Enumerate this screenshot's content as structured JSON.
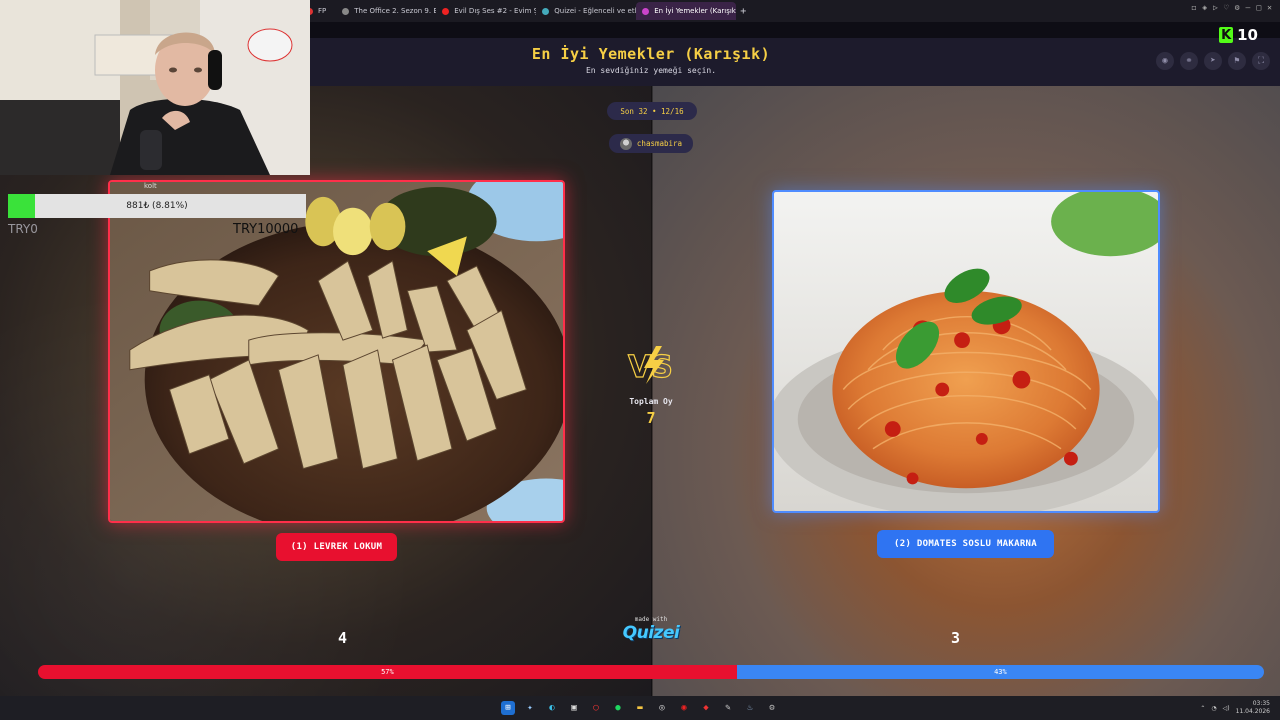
{
  "browser": {
    "tabs": [
      {
        "label": "FP",
        "color": "#d33"
      },
      {
        "label": "The Office 2. Sezon 9. Bö",
        "color": "#888"
      },
      {
        "label": "Evil Dış Ses #2 - Evim Şa",
        "color": "#e22"
      },
      {
        "label": "Quizei - Eğlenceli ve etkil",
        "color": "#4ab"
      },
      {
        "label": "En İyi Yemekler (Karışık)",
        "color": "#c4c",
        "active": true
      }
    ],
    "new_tab": "+",
    "kick_viewers": "10"
  },
  "header": {
    "title": "En İyi Yemekler (Karışık)",
    "subtitle": "En sevdiğiniz yemeği seçin.",
    "icons": [
      "eye-icon",
      "link-icon",
      "send-icon",
      "flag-icon",
      "fullscreen-icon"
    ]
  },
  "match": {
    "round": "Son 32 • 12/16",
    "user": "chasmabira",
    "left_choice": "(1) LEVREK LOKUM",
    "right_choice": "(2) DOMATES SOSLU MAKARNA",
    "total_label": "Toplam Oy",
    "total_votes": "7",
    "left_votes": "4",
    "right_votes": "3",
    "left_percent_label": "57%",
    "right_percent_label": "43%",
    "left_fraction": 0.57,
    "colors": {
      "left": "#e8102f",
      "right": "#2f74f2",
      "accent": "#f6cf45"
    }
  },
  "footer": {
    "made_with": "made with",
    "brand": "Quizei"
  },
  "overlay": {
    "donation_label": "kolt",
    "donation_text": "881₺ (8.81%)",
    "donation_fraction": 0.0881,
    "try_main": "TRY10000",
    "try_side": "TRY0"
  },
  "taskbar": {
    "time": "03:35",
    "date": "11.04.2026"
  }
}
